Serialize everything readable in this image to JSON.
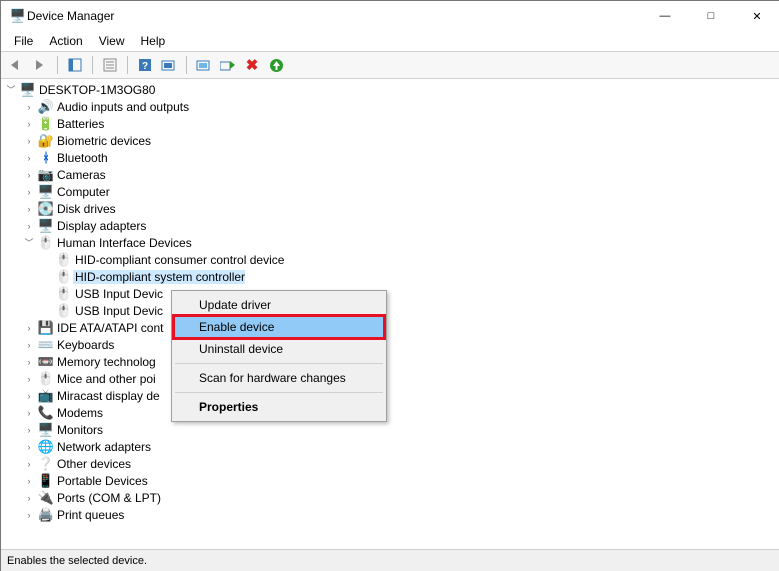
{
  "window": {
    "title": "Device Manager"
  },
  "menu": {
    "file": "File",
    "action": "Action",
    "view": "View",
    "help": "Help"
  },
  "root": {
    "label": "DESKTOP-1M3OG80"
  },
  "cats": {
    "audio": "Audio inputs and outputs",
    "batteries": "Batteries",
    "biometric": "Biometric devices",
    "bluetooth": "Bluetooth",
    "cameras": "Cameras",
    "computer": "Computer",
    "disk": "Disk drives",
    "display": "Display adapters",
    "hid": "Human Interface Devices",
    "ide": "IDE ATA/ATAPI cont",
    "keyboards": "Keyboards",
    "memory": "Memory technolog",
    "mice": "Mice and other poi",
    "miracast": "Miracast display de",
    "modems": "Modems",
    "monitors": "Monitors",
    "network": "Network adapters",
    "other": "Other devices",
    "portable": "Portable Devices",
    "ports": "Ports (COM & LPT)",
    "print": "Print queues"
  },
  "hid_children": {
    "c0": "HID-compliant consumer control device",
    "c1": "HID-compliant system controller",
    "c2": "USB Input Devic",
    "c3": "USB Input Devic"
  },
  "ctx": {
    "update": "Update driver",
    "enable": "Enable device",
    "uninstall": "Uninstall device",
    "scan": "Scan for hardware changes",
    "properties": "Properties"
  },
  "status": "Enables the selected device."
}
